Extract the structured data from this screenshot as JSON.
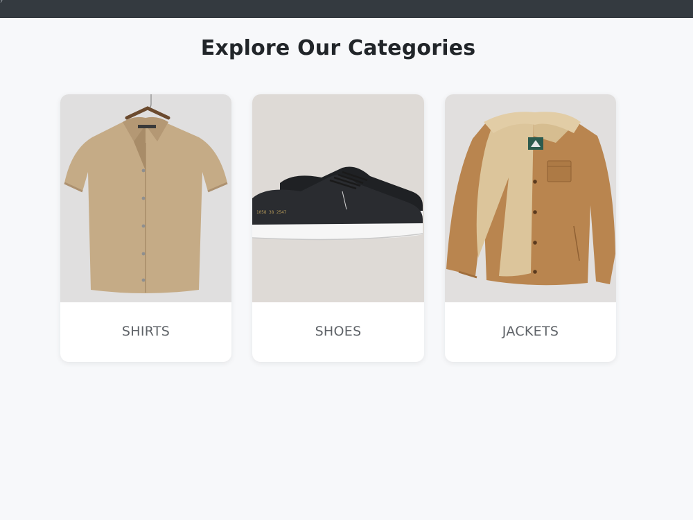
{
  "page": {
    "title": "Explore Our Categories"
  },
  "categories": [
    {
      "label": "SHIRTS",
      "icon": "shirt-image"
    },
    {
      "label": "SHOES",
      "icon": "shoes-image"
    },
    {
      "label": "JACKETS",
      "icon": "jacket-image"
    }
  ],
  "colors": {
    "topbar": "#343a40",
    "background": "#f7f8fa",
    "title": "#212529",
    "label": "#5f6368",
    "card": "#ffffff"
  }
}
